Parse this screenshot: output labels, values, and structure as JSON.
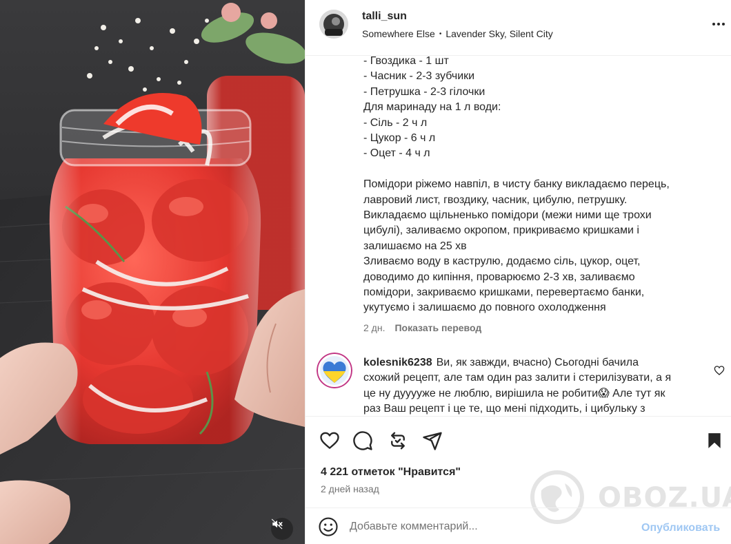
{
  "post": {
    "username": "talli_sun",
    "location_place": "Somewhere Else",
    "location_separator": "•",
    "location_detail": "Lavender Sky, Silent City"
  },
  "caption": {
    "lines": [
      "- Гвоздика - 1 шт",
      "- Часник - 2-3 зубчики",
      "- Петрушка - 2-3 гілочки",
      "Для маринаду на 1 л води:",
      "- Сіль - 2 ч л",
      "- Цукор - 6 ч л",
      "- Оцет - 4 ч л",
      "",
      "Помідори ріжемо навпіл, в чисту банку викладаємо перець,",
      "лавровий лист, гвоздику, часник, цибулю, петрушку.",
      "Викладаємо щільненько помідори (межи ними ще трохи",
      "цибулі), заливаємо окропом, прикриваємо кришками і",
      "залишаємо на 25 хв",
      "Зливаємо воду в каструлю, додаємо сіль, цукор, оцет,",
      "доводимо до кипіння, проварюємо 2-3 хв, заливаємо",
      "помідори, закриваємо кришками, перевертаємо банки,",
      "укутуємо і залишаємо до повного охолодження"
    ],
    "age": "2 дн.",
    "translate_label": "Показать перевод"
  },
  "comment": {
    "username": "kolesnik6238",
    "first_line": "Ви, як завжди, вчасно) Сьогодні бачила",
    "lines": [
      "схожий рецепт, але там один раз залити і стерилізувати, а я",
      "це ну дууууже не люблю, вирішила не робити😱  Але тут як",
      "раз Ваш рецепт і це те, що мені підходить, і цибульку з"
    ]
  },
  "actions": {
    "like_icon": "heart-icon",
    "comment_icon": "comment-icon",
    "share_icon": "repost-icon",
    "send_icon": "send-icon",
    "save_icon": "bookmark-icon"
  },
  "likes_text": "4 221 отметок \"Нравится\"",
  "post_date": "2 дней назад",
  "composer": {
    "placeholder": "Добавьте комментарий...",
    "publish_label": "Опубликовать"
  },
  "watermark": "OBOZ.UA",
  "colors": {
    "text": "#262626",
    "secondary": "#737373",
    "publish_disabled": "#9fc7f3",
    "border": "#efefef"
  }
}
